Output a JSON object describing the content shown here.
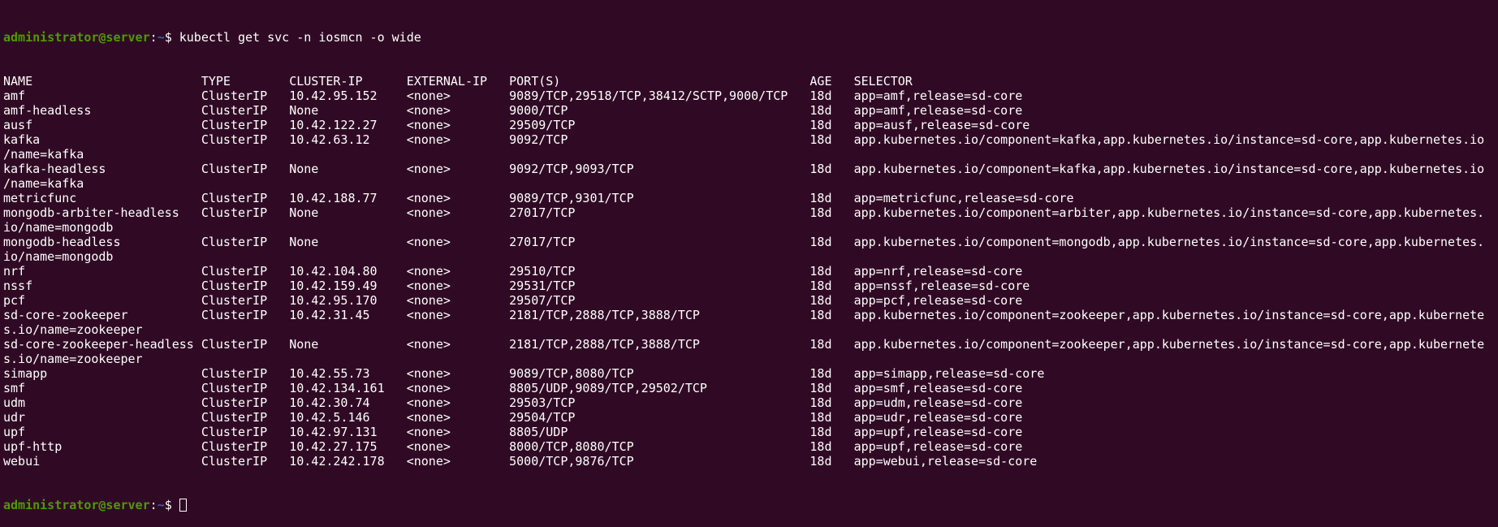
{
  "terminal": {
    "prompt": {
      "user_host": "administrator@server",
      "sep": ":",
      "path": "~",
      "symbol": "$ "
    },
    "command": "kubectl get svc -n iosmcn -o wide",
    "output_lines": [
      "NAME                       TYPE        CLUSTER-IP      EXTERNAL-IP   PORT(S)                                  AGE   SELECTOR",
      "amf                        ClusterIP   10.42.95.152    <none>        9089/TCP,29518/TCP,38412/SCTP,9000/TCP   18d   app=amf,release=sd-core",
      "amf-headless               ClusterIP   None            <none>        9000/TCP                                 18d   app=amf,release=sd-core",
      "ausf                       ClusterIP   10.42.122.27    <none>        29509/TCP                                18d   app=ausf,release=sd-core",
      "kafka                      ClusterIP   10.42.63.12     <none>        9092/TCP                                 18d   app.kubernetes.io/component=kafka,app.kubernetes.io/instance=sd-core,app.kubernetes.io",
      "/name=kafka",
      "kafka-headless             ClusterIP   None            <none>        9092/TCP,9093/TCP                        18d   app.kubernetes.io/component=kafka,app.kubernetes.io/instance=sd-core,app.kubernetes.io",
      "/name=kafka",
      "metricfunc                 ClusterIP   10.42.188.77    <none>        9089/TCP,9301/TCP                        18d   app=metricfunc,release=sd-core",
      "mongodb-arbiter-headless   ClusterIP   None            <none>        27017/TCP                                18d   app.kubernetes.io/component=arbiter,app.kubernetes.io/instance=sd-core,app.kubernetes.",
      "io/name=mongodb",
      "mongodb-headless           ClusterIP   None            <none>        27017/TCP                                18d   app.kubernetes.io/component=mongodb,app.kubernetes.io/instance=sd-core,app.kubernetes.",
      "io/name=mongodb",
      "nrf                        ClusterIP   10.42.104.80    <none>        29510/TCP                                18d   app=nrf,release=sd-core",
      "nssf                       ClusterIP   10.42.159.49    <none>        29531/TCP                                18d   app=nssf,release=sd-core",
      "pcf                        ClusterIP   10.42.95.170    <none>        29507/TCP                                18d   app=pcf,release=sd-core",
      "sd-core-zookeeper          ClusterIP   10.42.31.45     <none>        2181/TCP,2888/TCP,3888/TCP               18d   app.kubernetes.io/component=zookeeper,app.kubernetes.io/instance=sd-core,app.kubernete",
      "s.io/name=zookeeper",
      "sd-core-zookeeper-headless ClusterIP   None            <none>        2181/TCP,2888/TCP,3888/TCP               18d   app.kubernetes.io/component=zookeeper,app.kubernetes.io/instance=sd-core,app.kubernete",
      "s.io/name=zookeeper",
      "simapp                     ClusterIP   10.42.55.73     <none>        9089/TCP,8080/TCP                        18d   app=simapp,release=sd-core",
      "smf                        ClusterIP   10.42.134.161   <none>        8805/UDP,9089/TCP,29502/TCP              18d   app=smf,release=sd-core",
      "udm                        ClusterIP   10.42.30.74     <none>        29503/TCP                                18d   app=udm,release=sd-core",
      "udr                        ClusterIP   10.42.5.146     <none>        29504/TCP                                18d   app=udr,release=sd-core",
      "upf                        ClusterIP   10.42.97.131    <none>        8805/UDP                                 18d   app=upf,release=sd-core",
      "upf-http                   ClusterIP   10.42.27.175    <none>        8000/TCP,8080/TCP                        18d   app=upf,release=sd-core",
      "webui                      ClusterIP   10.42.242.178   <none>        5000/TCP,9876/TCP                        18d   app=webui,release=sd-core"
    ]
  }
}
